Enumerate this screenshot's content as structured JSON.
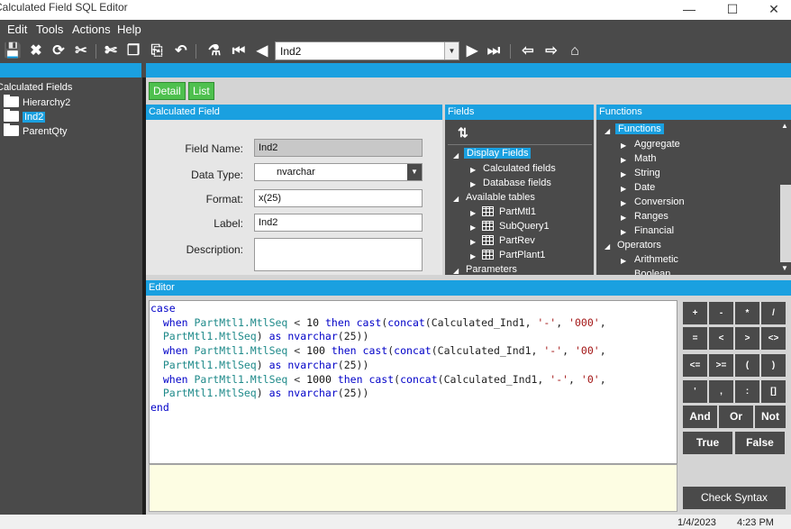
{
  "window": {
    "title": "Calculated Field SQL Editor"
  },
  "menu": [
    "Edit",
    "Tools",
    "Actions",
    "Help"
  ],
  "toolbar": {
    "icons": [
      "save-icon",
      "delete-icon",
      "refresh-icon",
      "clear-icon",
      "cut-icon",
      "copy-icon",
      "paste-icon",
      "undo-icon",
      "search-icon",
      "first-icon",
      "prev-icon",
      "next-icon",
      "last-icon",
      "back-icon",
      "forward-icon",
      "home-icon"
    ],
    "nav_value": "Ind2"
  },
  "tree": {
    "root": "Calculated Fields",
    "items": [
      "Hierarchy2",
      "Ind2",
      "ParentQty"
    ]
  },
  "tabs": [
    "Detail",
    "List"
  ],
  "calc_field": {
    "header": "Calculated Field",
    "field_name_label": "Field Name:",
    "field_name": "Ind2",
    "data_type_label": "Data Type:",
    "data_type": "nvarchar",
    "format_label": "Format:",
    "format": "x(25)",
    "label_label": "Label:",
    "label": "Ind2",
    "description_label": "Description:",
    "description": ""
  },
  "fields": {
    "header": "Fields",
    "display_fields": "Display Fields",
    "calculated_fields": "Calculated fields",
    "database_fields": "Database fields",
    "available_tables": "Available tables",
    "tables": [
      "PartMtl1",
      "SubQuery1",
      "PartRev",
      "PartPlant1"
    ],
    "parameters": "Parameters"
  },
  "functions": {
    "header": "Functions",
    "root": "Functions",
    "items": [
      "Aggregate",
      "Math",
      "String",
      "Date",
      "Conversion",
      "Ranges",
      "Financial"
    ],
    "operators": "Operators",
    "operator_items": [
      "Arithmetic",
      "Boolean"
    ]
  },
  "editor": {
    "header": "Editor"
  },
  "operators_pad": {
    "row1": [
      "+",
      "-",
      "*",
      "/"
    ],
    "row2": [
      "=",
      "<",
      ">",
      "<>"
    ],
    "row3": [
      "<=",
      ">=",
      "(",
      ")"
    ],
    "row4": [
      "'",
      ",",
      ":",
      "[]"
    ],
    "row5": [
      "And",
      "Or",
      "Not"
    ],
    "true_label": "True",
    "false_label": "False",
    "check_syntax": "Check Syntax"
  },
  "status": {
    "date": "1/4/2023",
    "time": "4:23 PM"
  },
  "colors": {
    "accent": "#1aa0e0",
    "dark": "#4a4a4a",
    "tab": "#4ec04e"
  }
}
